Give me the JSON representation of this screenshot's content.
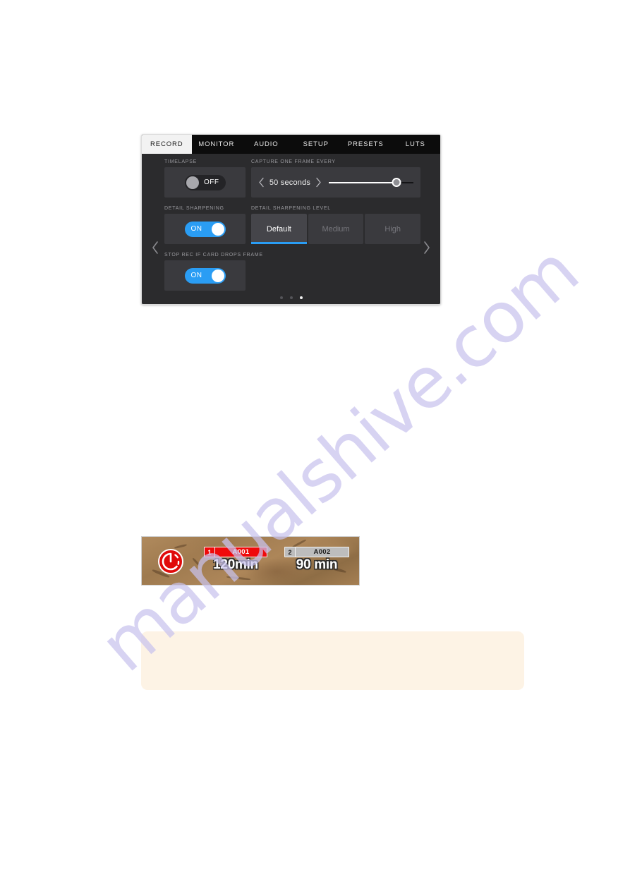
{
  "settings_panel": {
    "tabs": [
      {
        "label": "RECORD",
        "active": true
      },
      {
        "label": "MONITOR",
        "active": false
      },
      {
        "label": "AUDIO",
        "active": false
      },
      {
        "label": "SETUP",
        "active": false
      },
      {
        "label": "PRESETS",
        "active": false
      },
      {
        "label": "LUTS",
        "active": false
      }
    ],
    "nav": {
      "prev_icon": "chevron-left-icon",
      "next_icon": "chevron-right-icon"
    },
    "fields": {
      "timelapse": {
        "label": "TIMELAPSE",
        "toggle_state": "OFF"
      },
      "capture_one_frame_every": {
        "label": "CAPTURE ONE FRAME EVERY",
        "value": "50 seconds",
        "decrement_icon": "chevron-left-icon",
        "increment_icon": "chevron-right-icon",
        "slider_percent": 80
      },
      "detail_sharpening": {
        "label": "DETAIL SHARPENING",
        "toggle_state": "ON"
      },
      "detail_sharpening_level": {
        "label": "DETAIL SHARPENING LEVEL",
        "options": [
          {
            "label": "Default",
            "active": true
          },
          {
            "label": "Medium",
            "active": false
          },
          {
            "label": "High",
            "active": false
          }
        ]
      },
      "stop_rec_if_card_drops_frame": {
        "label": "STOP REC IF CARD DROPS FRAME",
        "toggle_state": "ON"
      }
    },
    "page_dots": [
      {
        "active": false
      },
      {
        "active": false
      },
      {
        "active": true
      }
    ]
  },
  "storage_indicator": {
    "record_icon": "timelapse-record-icon",
    "cards": [
      {
        "number": "1",
        "name": "A001",
        "remaining": "120min",
        "status": "recording"
      },
      {
        "number": "2",
        "name": "A002",
        "remaining": "90 min",
        "status": "idle"
      }
    ]
  },
  "note_box": {
    "text": ""
  },
  "watermark": {
    "text": "manualshive.com"
  },
  "colors": {
    "accent_blue": "#2a9df4",
    "record_red": "#ef0a0a",
    "panel_bg": "#2b2b2d",
    "field_bg": "#3a3a3e",
    "tabbar_bg": "#0c0c0c",
    "note_bg": "#fdf3e5",
    "watermark": "#c9c3ee"
  }
}
